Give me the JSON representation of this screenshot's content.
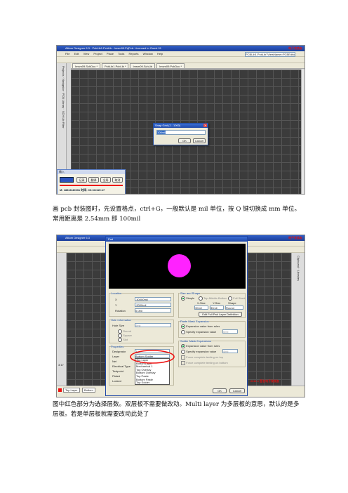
{
  "shot1": {
    "watermark": "电子发烧友",
    "window_title": "Altium Designer 6.3 - PcbLib1.PcbLib - Imsm09.PrjPcb. Licensed to Guest 01",
    "menu": [
      "File",
      "Edit",
      "View",
      "Project",
      "Place",
      "Tools",
      "Reports",
      "Window",
      "Help"
    ],
    "path_box": "PCBLib1.PcbLib?ViewName=PCBEdito ▾",
    "tabs": [
      "Imsm09.SchDoc *",
      "PcbLib1.PcbLib *",
      "Imsm09.SchLib",
      "Imsm09.PcbDoc *"
    ],
    "side_labels": [
      "Projects",
      "Navigator",
      "PCB Library",
      "SCH Lib Filter"
    ],
    "dialog": {
      "title": "Snap Grid (1...1000)",
      "value": "100mil",
      "ok": "OK",
      "cancel": "Cancel"
    },
    "ime": {
      "title": "输入",
      "buttons": [
        "记录",
        "翻译",
        "全局",
        "取消"
      ],
      "status": "M: 18816/40031 时间: 00:31/115:17"
    }
  },
  "caption1": "画 pcb 封装图时，先设置格点，ctrl+G，一般默认是 mil 单位，按 Q 键切换成 mm 单位。常用距离是 2.54mm 即 100mil",
  "shot2": {
    "watermark": "电子发烧友",
    "window_title": "Altium Designer 6.3",
    "pad_title": "Pad",
    "location": {
      "label": "Location",
      "x_label": "X",
      "x": "-30000mil",
      "y_label": "Y",
      "y": "-2000mil",
      "rot_label": "Rotation",
      "rot": "0.000"
    },
    "hole": {
      "label": "Hole Information",
      "size_label": "Hole Size",
      "size": "0mil",
      "opts": [
        "Round",
        "Square",
        "Slot"
      ]
    },
    "properties": {
      "label": "Properties",
      "rows": [
        "Designator",
        "Layer",
        "Net",
        "Electrical Type",
        "Testpoint",
        "Plated",
        "Locked"
      ],
      "designator": "1",
      "layer": "Bottom Solder"
    },
    "layer_list": [
      "Top Layer",
      "BottomLayer",
      "Mechanical 1",
      "Top Overlay",
      "Bottom Overlay",
      "Top Paste",
      "Bottom Paste",
      "Top Solder"
    ],
    "shape": {
      "label": "Size and Shape",
      "opts": [
        "Simple",
        "Top-Middle-Bottom",
        "Full Stack"
      ],
      "cols": [
        "X-Size",
        "Y-Size",
        "Shape"
      ],
      "x": "30mil",
      "y": "30mil",
      "shape": "Round",
      "edit_btn": "Edit Full Pad Layer Definition"
    },
    "paste": {
      "label": "Paste Mask Expansion",
      "opts": [
        "Expansion value from rules",
        "Specify expansion value"
      ],
      "val": "0mil"
    },
    "solder": {
      "label": "Solder Mask Expansions",
      "opts": [
        "Expansion value from rules",
        "Specify expansion value"
      ],
      "val": "4mil",
      "force": [
        "Force complete tenting on top",
        "Force complete tenting on bottom"
      ]
    },
    "ok": "OK",
    "cancel": "Cancel",
    "footer_tabs": [
      "Top Layer",
      "Bottom"
    ],
    "side_right": [
      "Clipboard",
      "Libraries"
    ],
    "status_left": "3:17",
    "stamp": "2011.1 签名电子发烧友"
  },
  "caption2": "图中红色部分为选择层数。双层板不需要做改动。Multi layer 为多层板的意思，默认的是多层板。若是单层板就需要改动此处了",
  "colors": {
    "pad": "#ff22ff",
    "grid_bg": "#3b3b3b",
    "highlight": "#e11"
  }
}
